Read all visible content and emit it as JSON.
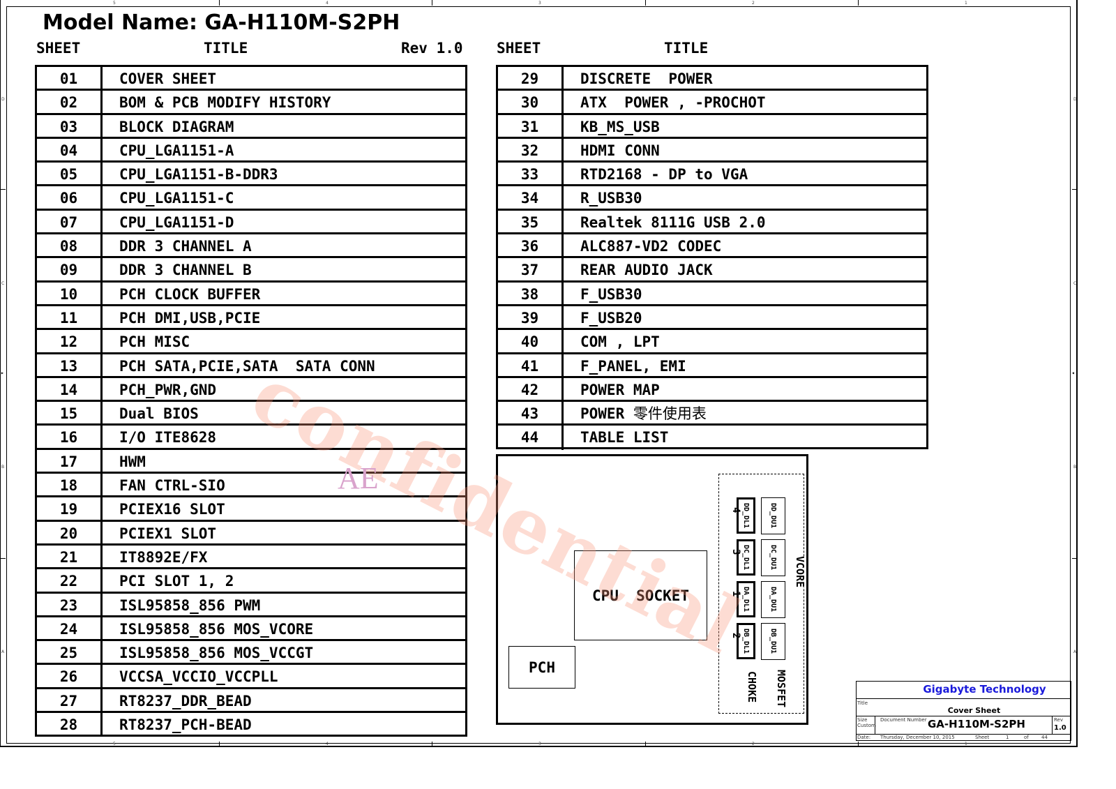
{
  "header": {
    "model_title": "Model Name: GA-H110M-S2PH",
    "left_col_sheet": "SHEET",
    "left_col_title": "TITLE",
    "revision": "Rev 1.0",
    "right_col_sheet": "SHEET",
    "right_col_title": "TITLE"
  },
  "sheets_left": [
    {
      "num": "01",
      "title": "COVER SHEET"
    },
    {
      "num": "02",
      "title": "BOM & PCB MODIFY HISTORY"
    },
    {
      "num": "03",
      "title": "BLOCK DIAGRAM"
    },
    {
      "num": "04",
      "title": "CPU_LGA1151-A"
    },
    {
      "num": "05",
      "title": "CPU_LGA1151-B-DDR3"
    },
    {
      "num": "06",
      "title": "CPU_LGA1151-C"
    },
    {
      "num": "07",
      "title": "CPU_LGA1151-D"
    },
    {
      "num": "08",
      "title": "DDR 3 CHANNEL A"
    },
    {
      "num": "09",
      "title": "DDR 3 CHANNEL B"
    },
    {
      "num": "10",
      "title": "PCH CLOCK BUFFER"
    },
    {
      "num": "11",
      "title": "PCH DMI,USB,PCIE"
    },
    {
      "num": "12",
      "title": "PCH MISC"
    },
    {
      "num": "13",
      "title": "PCH SATA,PCIE,SATA  SATA CONN"
    },
    {
      "num": "14",
      "title": "PCH_PWR,GND"
    },
    {
      "num": "15",
      "title": "Dual BIOS"
    },
    {
      "num": "16",
      "title": "I/O ITE8628"
    },
    {
      "num": "17",
      "title": "HWM"
    },
    {
      "num": "18",
      "title": "FAN CTRL-SIO"
    },
    {
      "num": "19",
      "title": "PCIEX16 SLOT"
    },
    {
      "num": "20",
      "title": "PCIEX1 SLOT"
    },
    {
      "num": "21",
      "title": "IT8892E/FX"
    },
    {
      "num": "22",
      "title": "PCI SLOT 1, 2"
    },
    {
      "num": "23",
      "title": "ISL95858_856 PWM"
    },
    {
      "num": "24",
      "title": "ISL95858_856 MOS_VCORE"
    },
    {
      "num": "25",
      "title": "ISL95858_856 MOS_VCCGT"
    },
    {
      "num": "26",
      "title": "VCCSA_VCCIO_VCCPLL"
    },
    {
      "num": "27",
      "title": "RT8237_DDR_BEAD"
    },
    {
      "num": "28",
      "title": "RT8237_PCH-BEAD"
    }
  ],
  "sheets_right": [
    {
      "num": "29",
      "title": "DISCRETE  POWER"
    },
    {
      "num": "30",
      "title": "ATX  POWER , -PROCHOT"
    },
    {
      "num": "31",
      "title": "KB_MS_USB"
    },
    {
      "num": "32",
      "title": "HDMI CONN"
    },
    {
      "num": "33",
      "title": "RTD2168 - DP to VGA"
    },
    {
      "num": "34",
      "title": "R_USB30"
    },
    {
      "num": "35",
      "title": "Realtek 8111G USB 2.0"
    },
    {
      "num": "36",
      "title": "ALC887-VD2 CODEC"
    },
    {
      "num": "37",
      "title": "REAR AUDIO JACK"
    },
    {
      "num": "38",
      "title": "F_USB30"
    },
    {
      "num": "39",
      "title": "F_USB20"
    },
    {
      "num": "40",
      "title": "COM , LPT"
    },
    {
      "num": "41",
      "title": "F_PANEL, EMI"
    },
    {
      "num": "42",
      "title": "POWER MAP"
    },
    {
      "num": "43",
      "title": "POWER ",
      "title_cjk": "零件使用表"
    },
    {
      "num": "44",
      "title": "TABLE LIST"
    }
  ],
  "board": {
    "cpu_socket": "CPU  SOCKET",
    "pch": "PCH",
    "vcore_label": "VCORE",
    "choke_label": "CHOKE",
    "mosfet_label": "MOSFET",
    "phases": [
      {
        "choke": "DD_DL1",
        "mosfet": "DD_DU1",
        "phase_num": "4"
      },
      {
        "choke": "DC_DL1",
        "mosfet": "DC_DU1",
        "phase_num": "3"
      },
      {
        "choke": "DA_DL1",
        "mosfet": "DA_DU1",
        "phase_num": "1"
      },
      {
        "choke": "DB_DL1",
        "mosfet": "DB_DU1",
        "phase_num": "2"
      }
    ]
  },
  "watermarks": {
    "confidential": "confidential",
    "ae": "AE"
  },
  "title_block": {
    "company": "Gigabyte Technology",
    "title_label": "Title",
    "title_value": "Cover Sheet",
    "size_label": "Size",
    "size_value": "Custom",
    "doc_number_label": "Document Number",
    "doc_number_value": "GA-H110M-S2PH",
    "rev_label": "Rev",
    "rev_value": "1.0",
    "date_label": "Date:",
    "date_value": "Thursday, December 10, 2015",
    "sheet_label": "Sheet",
    "sheet_value": "1",
    "of_label": "of",
    "total_sheets": "44"
  },
  "frame": {
    "col_zones": [
      "5",
      "4",
      "3",
      "2",
      "1"
    ],
    "row_zones": [
      "D",
      "C",
      "B",
      "A"
    ]
  }
}
